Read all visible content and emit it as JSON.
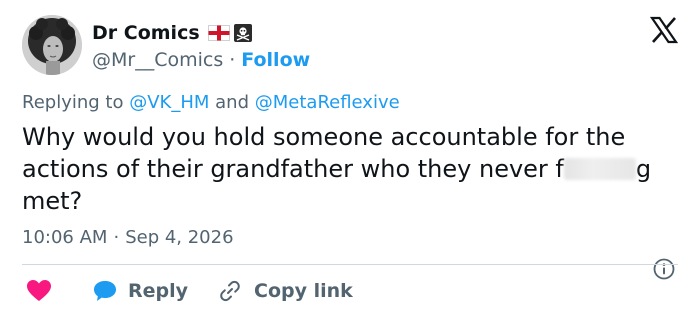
{
  "author": {
    "display_name": "Dr Comics",
    "handle": "@Mr__Comics",
    "follow_label": "Follow",
    "separator": "·",
    "badges": [
      "england-flag-icon",
      "pirate-flag-icon"
    ]
  },
  "reply_context": {
    "prefix": "Replying to",
    "mention_1": "@VK_HM",
    "conjunction": "and",
    "mention_2": "@MetaReflexive"
  },
  "tweet": {
    "text_before": "Why would you hold someone accountable for the actions of their grandfather who they never f",
    "text_after": "g met?"
  },
  "meta": {
    "time": "10:06 AM",
    "separator": "·",
    "date": "Sep 4, 2026"
  },
  "actions": {
    "reply_label": "Reply",
    "copy_link_label": "Copy link"
  },
  "colors": {
    "accent": "#1d9bf0",
    "heart": "#f91880",
    "text_secondary": "#536471",
    "divider": "#cfd9de"
  }
}
